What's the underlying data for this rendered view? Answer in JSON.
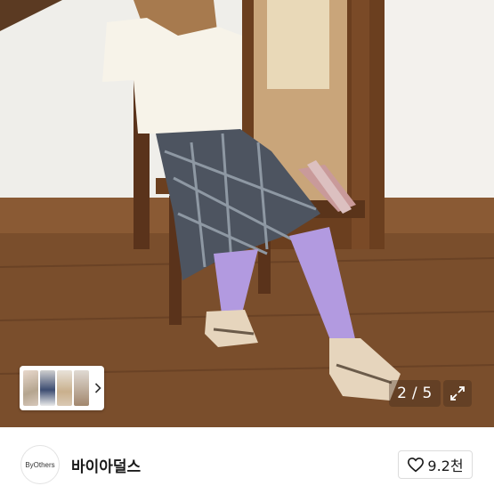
{
  "gallery": {
    "current_page": "2",
    "separator": "/",
    "total_pages": "5"
  },
  "shop": {
    "logo_text": "ByOthers",
    "name": "바이아덜스"
  },
  "like": {
    "count": "9.2천"
  },
  "icons": {
    "thumbnail_next": "chevron-right-icon",
    "expand": "expand-icon",
    "like": "heart-outline-icon"
  }
}
